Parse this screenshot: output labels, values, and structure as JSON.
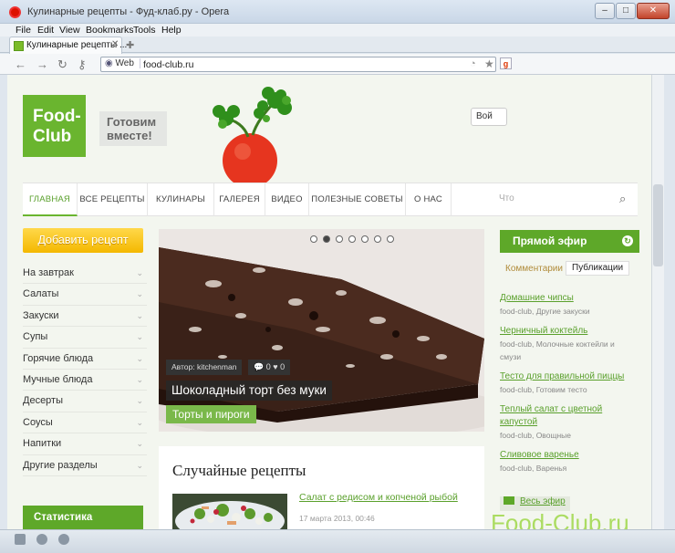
{
  "window": {
    "title": "Кулинарные рецепты - Фуд-клаб.ру - Opera",
    "controls": {
      "minimize": "–",
      "maximize": "□",
      "close": "✕"
    }
  },
  "menu": [
    "File",
    "Edit",
    "View",
    "Bookmarks",
    "Tools",
    "Help"
  ],
  "tab": {
    "label": "Кулинарные рецепты ...",
    "close": "✕",
    "new_tab": "✚"
  },
  "address": {
    "web_label": "Web",
    "url": "food-club.ru"
  },
  "header": {
    "logo_line1": "Food-",
    "logo_line2": "Club",
    "tagline": "Готовим вместе!",
    "login_stub": "Вой"
  },
  "nav": {
    "items": [
      "ГЛАВНАЯ",
      "ВСЕ РЕЦЕПТЫ",
      "КУЛИНАРЫ",
      "ГАЛЕРЕЯ",
      "ВИДЕО",
      "ПОЛЕЗНЫЕ СОВЕТЫ",
      "О НАС"
    ],
    "search_placeholder": "Что"
  },
  "sidebar": {
    "add_recipe": "Добавить рецепт",
    "categories": [
      "На завтрак",
      "Салаты",
      "Закуски",
      "Супы",
      "Горячие блюда",
      "Мучные блюда",
      "Десерты",
      "Соусы",
      "Напитки",
      "Другие разделы"
    ],
    "stats": "Статистика"
  },
  "slider": {
    "author": "Автор: kitchenman",
    "comments": "0",
    "likes": "0",
    "title": "Шоколадный торт без муки",
    "category": "Торты и пироги",
    "dots": 7,
    "active_dot": 1
  },
  "random": {
    "title": "Случайные рецепты",
    "item": {
      "link": "Салат с редисом и копченой рыбой",
      "date": "17 марта 2013, 00:46"
    }
  },
  "live": {
    "header": "Прямой эфир",
    "tabs": [
      "Комментарии",
      "Публикации"
    ],
    "items": [
      {
        "title": "Домашние чипсы",
        "meta": "food-club, Другие закуски"
      },
      {
        "title": "Черничный коктейль",
        "meta": "food-club, Молочные коктейли и смузи"
      },
      {
        "title": "Тесто для правильной пиццы",
        "meta": "food-club, Готовим тесто"
      },
      {
        "title": "Теплый салат с цветной капустой",
        "meta": "food-club, Овощные"
      },
      {
        "title": "Сливовое варенье",
        "meta": "food-club, Варенья"
      }
    ],
    "all_link": "Весь эфир"
  },
  "watermark": "Food-Club.ru",
  "colors": {
    "brand_green": "#6ab52f",
    "accent_yellow": "#f4b800",
    "link_green": "#5aa02c"
  }
}
